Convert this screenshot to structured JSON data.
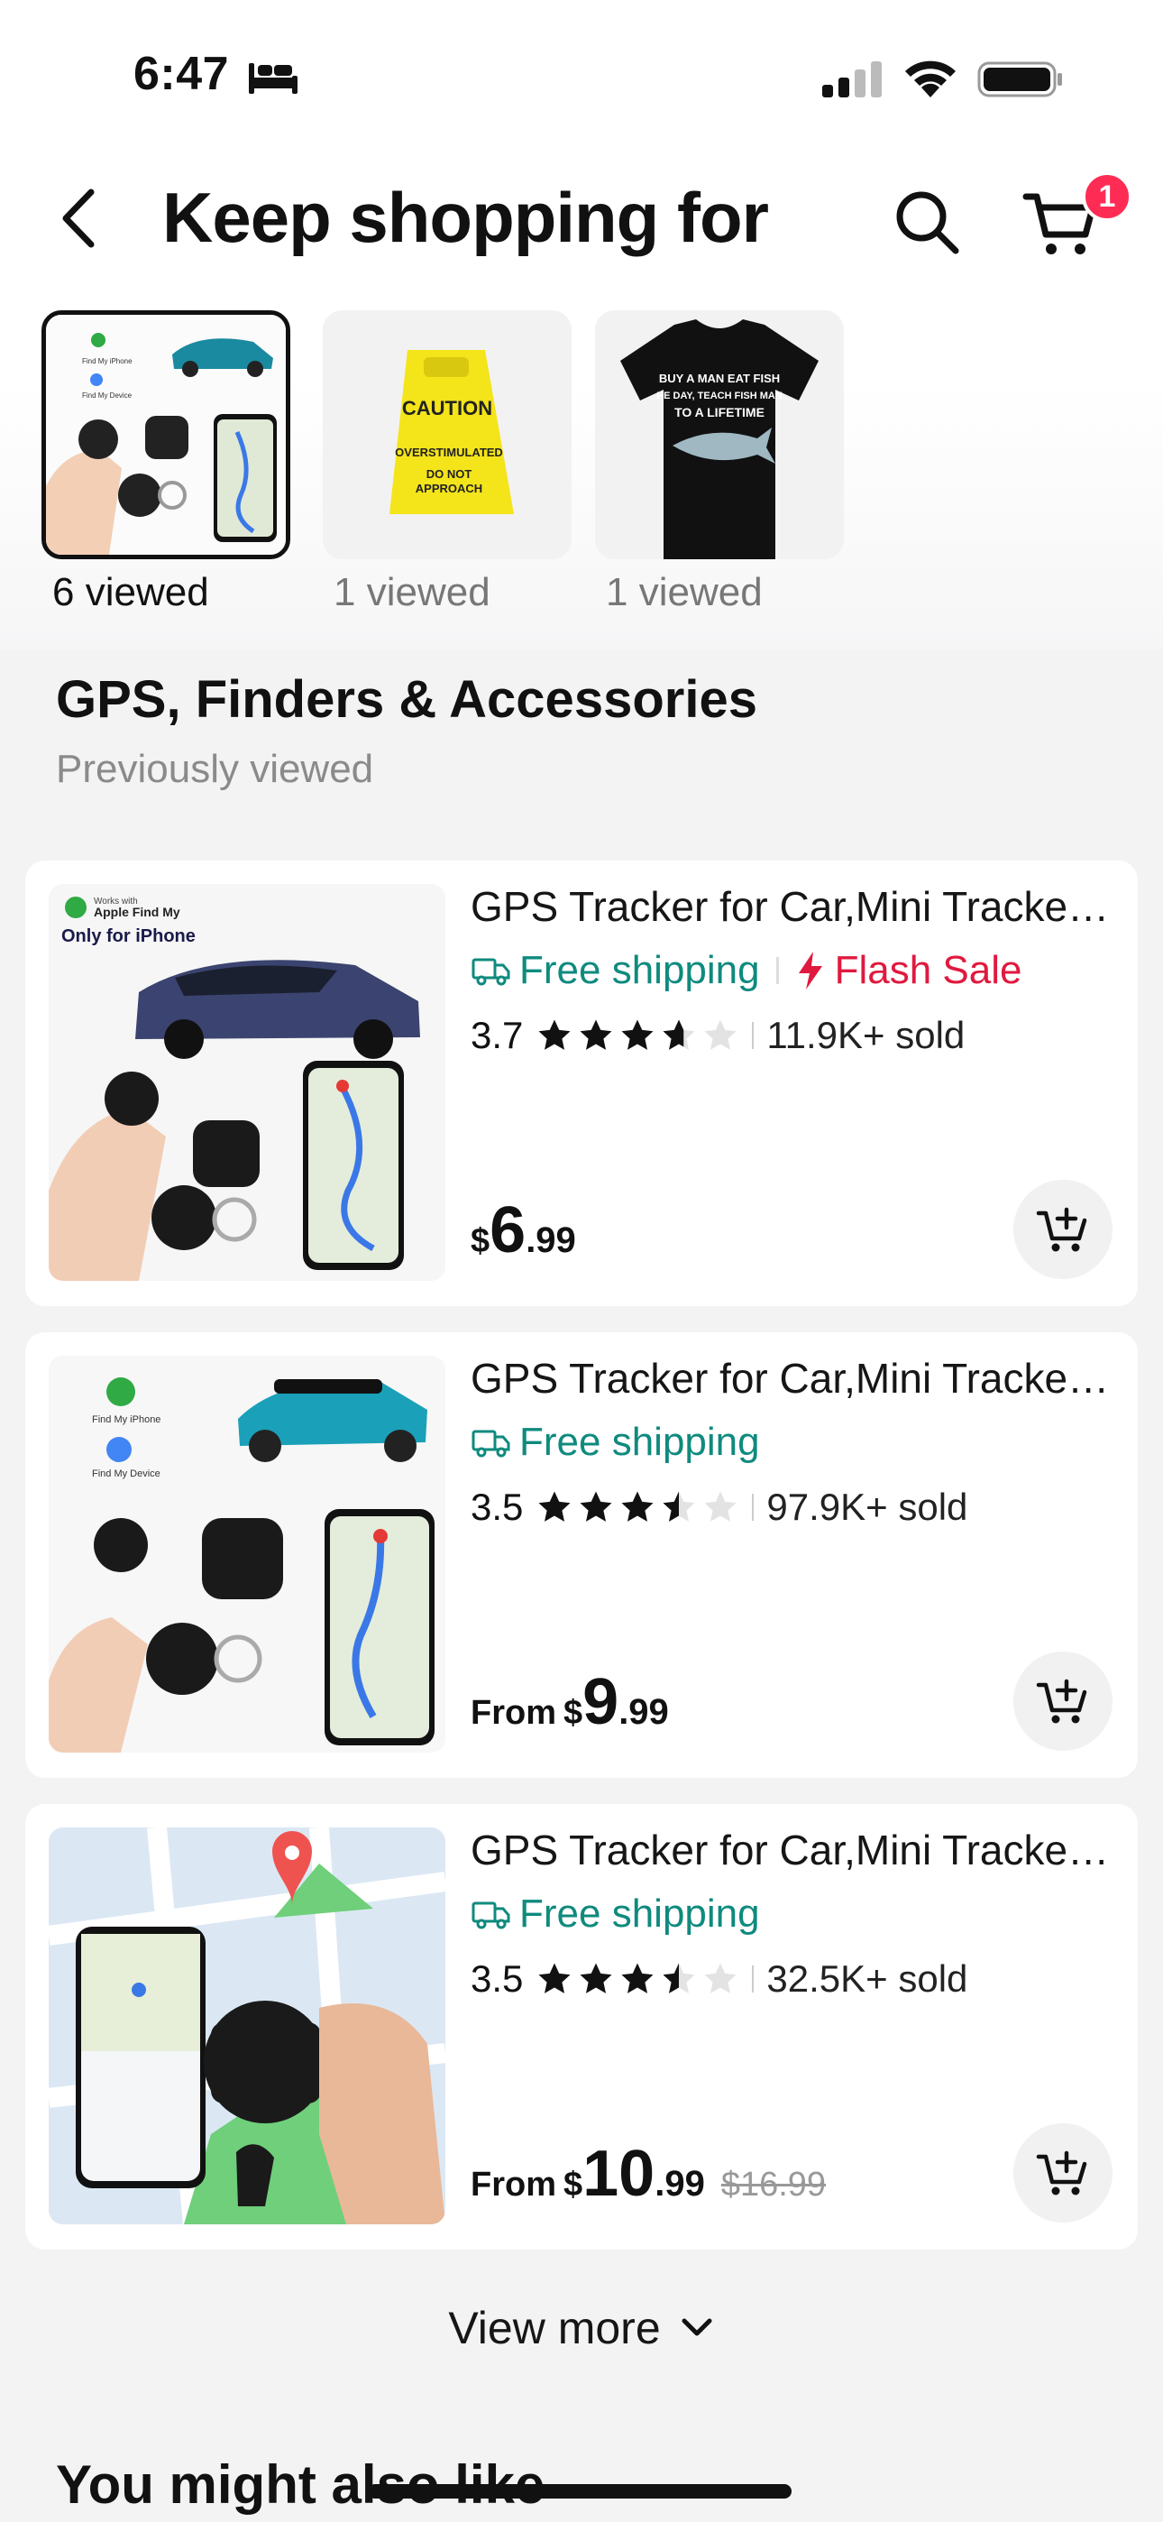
{
  "status_bar": {
    "time": "6:47",
    "icons": [
      "bed-icon",
      "cellular-signal-icon",
      "wifi-icon",
      "battery-icon"
    ]
  },
  "header": {
    "title": "Keep shopping for",
    "cart_badge": "1",
    "icons": [
      "back-arrow-icon",
      "search-icon",
      "cart-icon"
    ]
  },
  "viewed": [
    {
      "label": "6 viewed",
      "selected": true
    },
    {
      "label": "1 viewed",
      "selected": false
    },
    {
      "label": "1 viewed",
      "selected": false
    }
  ],
  "viewed_images": {
    "caution_sign": {
      "line1": "CAUTION",
      "line2": "OVERSTIMULATED",
      "line3": "DO NOT",
      "line4": "APPROACH"
    },
    "tshirt": {
      "line1": "BUY A MAN EAT FISH",
      "line2": "HE DAY, TEACH FISH MAN",
      "line3": "TO A LIFETIME"
    },
    "tracker_small": {
      "line1": "Find My iPhone",
      "line2": "Find My Device"
    }
  },
  "section": {
    "title": "GPS, Finders & Accessories",
    "subtitle": "Previously viewed"
  },
  "products": [
    {
      "title": "GPS Tracker for Car,Mini Trackers...",
      "shipping": "Free shipping",
      "flash": "Flash Sale",
      "rating": "3.7",
      "sold": "11.9K+ sold",
      "price_prefix": "",
      "currency": "$",
      "price_int": "6",
      "price_dec": ".99",
      "price_old": "",
      "image_text": {
        "badge_small": "Works with",
        "badge_big": "Apple Find My",
        "headline": "Only for iPhone"
      }
    },
    {
      "title": "GPS Tracker for Car,Mini Trackers...",
      "shipping": "Free shipping",
      "flash": "",
      "rating": "3.5",
      "sold": "97.9K+ sold",
      "price_prefix": "From",
      "currency": "$",
      "price_int": "9",
      "price_dec": ".99",
      "price_old": "",
      "image_text": {
        "line1": "Find My iPhone",
        "line2": "Find My Device"
      }
    },
    {
      "title": "GPS Tracker for Car,Mini Trackers...",
      "shipping": "Free shipping",
      "flash": "",
      "rating": "3.5",
      "sold": "32.5K+ sold",
      "price_prefix": "From",
      "currency": "$",
      "price_int": "10",
      "price_dec": ".99",
      "price_old": "$16.99"
    }
  ],
  "view_more": "View more",
  "also_like": "You might also like",
  "colors": {
    "accent_red": "#fe2c55",
    "shipping_teal": "#0f8a7e",
    "flash_red": "#e0193e"
  }
}
